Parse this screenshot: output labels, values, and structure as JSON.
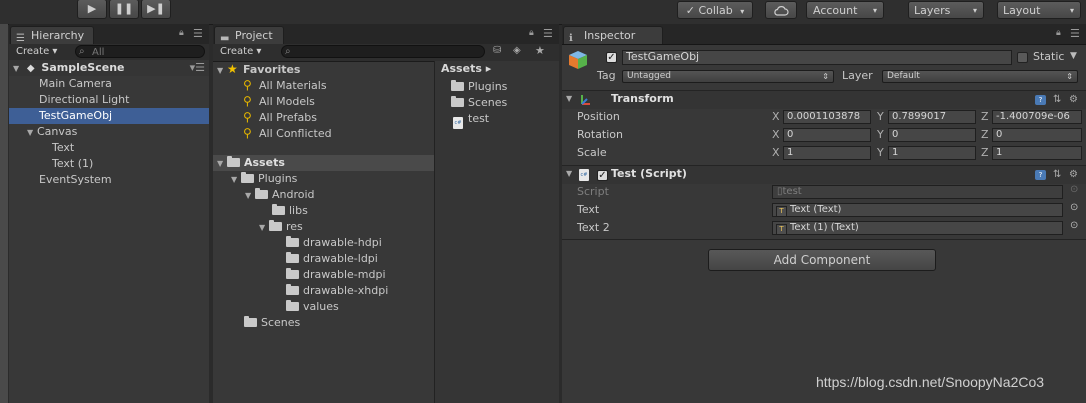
{
  "toolbar": {
    "play": "▶",
    "pause": "❚❚",
    "step": "▶❚",
    "collab_label": "Collab",
    "cloud_icon": "cloud-icon",
    "account_label": "Account",
    "layers_label": "Layers",
    "layout_label": "Layout",
    "check_icon": "✓",
    "caret": "▾"
  },
  "hierarchy": {
    "tab": "Hierarchy",
    "create": "Create ▾",
    "search_placeholder": "All",
    "scene": "SampleScene",
    "items": [
      "Main Camera",
      "Directional Light",
      "TestGameObj",
      "Canvas",
      "Text",
      "Text (1)",
      "EventSystem"
    ],
    "selected": "TestGameObj"
  },
  "project": {
    "tab": "Project",
    "create": "Create ▾",
    "favorites": {
      "title": "Favorites",
      "items": [
        "All Materials",
        "All Models",
        "All Prefabs",
        "All Conflicted"
      ]
    },
    "tree": {
      "root": "Assets",
      "plugins": "Plugins",
      "android": "Android",
      "libs": "libs",
      "res": "res",
      "res_children": [
        "drawable-hdpi",
        "drawable-ldpi",
        "drawable-mdpi",
        "drawable-xhdpi",
        "values"
      ],
      "scenes": "Scenes"
    },
    "assets_header": "Assets ▸",
    "assets_list": [
      "Plugins",
      "Scenes",
      "test"
    ]
  },
  "inspector": {
    "tab": "Inspector",
    "object_name": "TestGameObj",
    "static_label": "Static",
    "tag_label": "Tag",
    "tag_value": "Untagged",
    "layer_label": "Layer",
    "layer_value": "Default",
    "transform": {
      "title": "Transform",
      "position_label": "Position",
      "rotation_label": "Rotation",
      "scale_label": "Scale",
      "position": {
        "x": "0.0001103878",
        "y": "0.7899017",
        "z": "-1.400709e-06"
      },
      "rotation": {
        "x": "0",
        "y": "0",
        "z": "0"
      },
      "scale": {
        "x": "1",
        "y": "1",
        "z": "1"
      },
      "axis_x": "X",
      "axis_y": "Y",
      "axis_z": "Z"
    },
    "script_component": {
      "title": "Test (Script)",
      "script_label": "Script",
      "script_value": "test",
      "text_label": "Text",
      "text_value": "Text (Text)",
      "text2_label": "Text 2",
      "text2_value": "Text (1) (Text)"
    },
    "add_component": "Add Component"
  },
  "watermark": "https://blog.csdn.net/SnoopyNa2Co3"
}
